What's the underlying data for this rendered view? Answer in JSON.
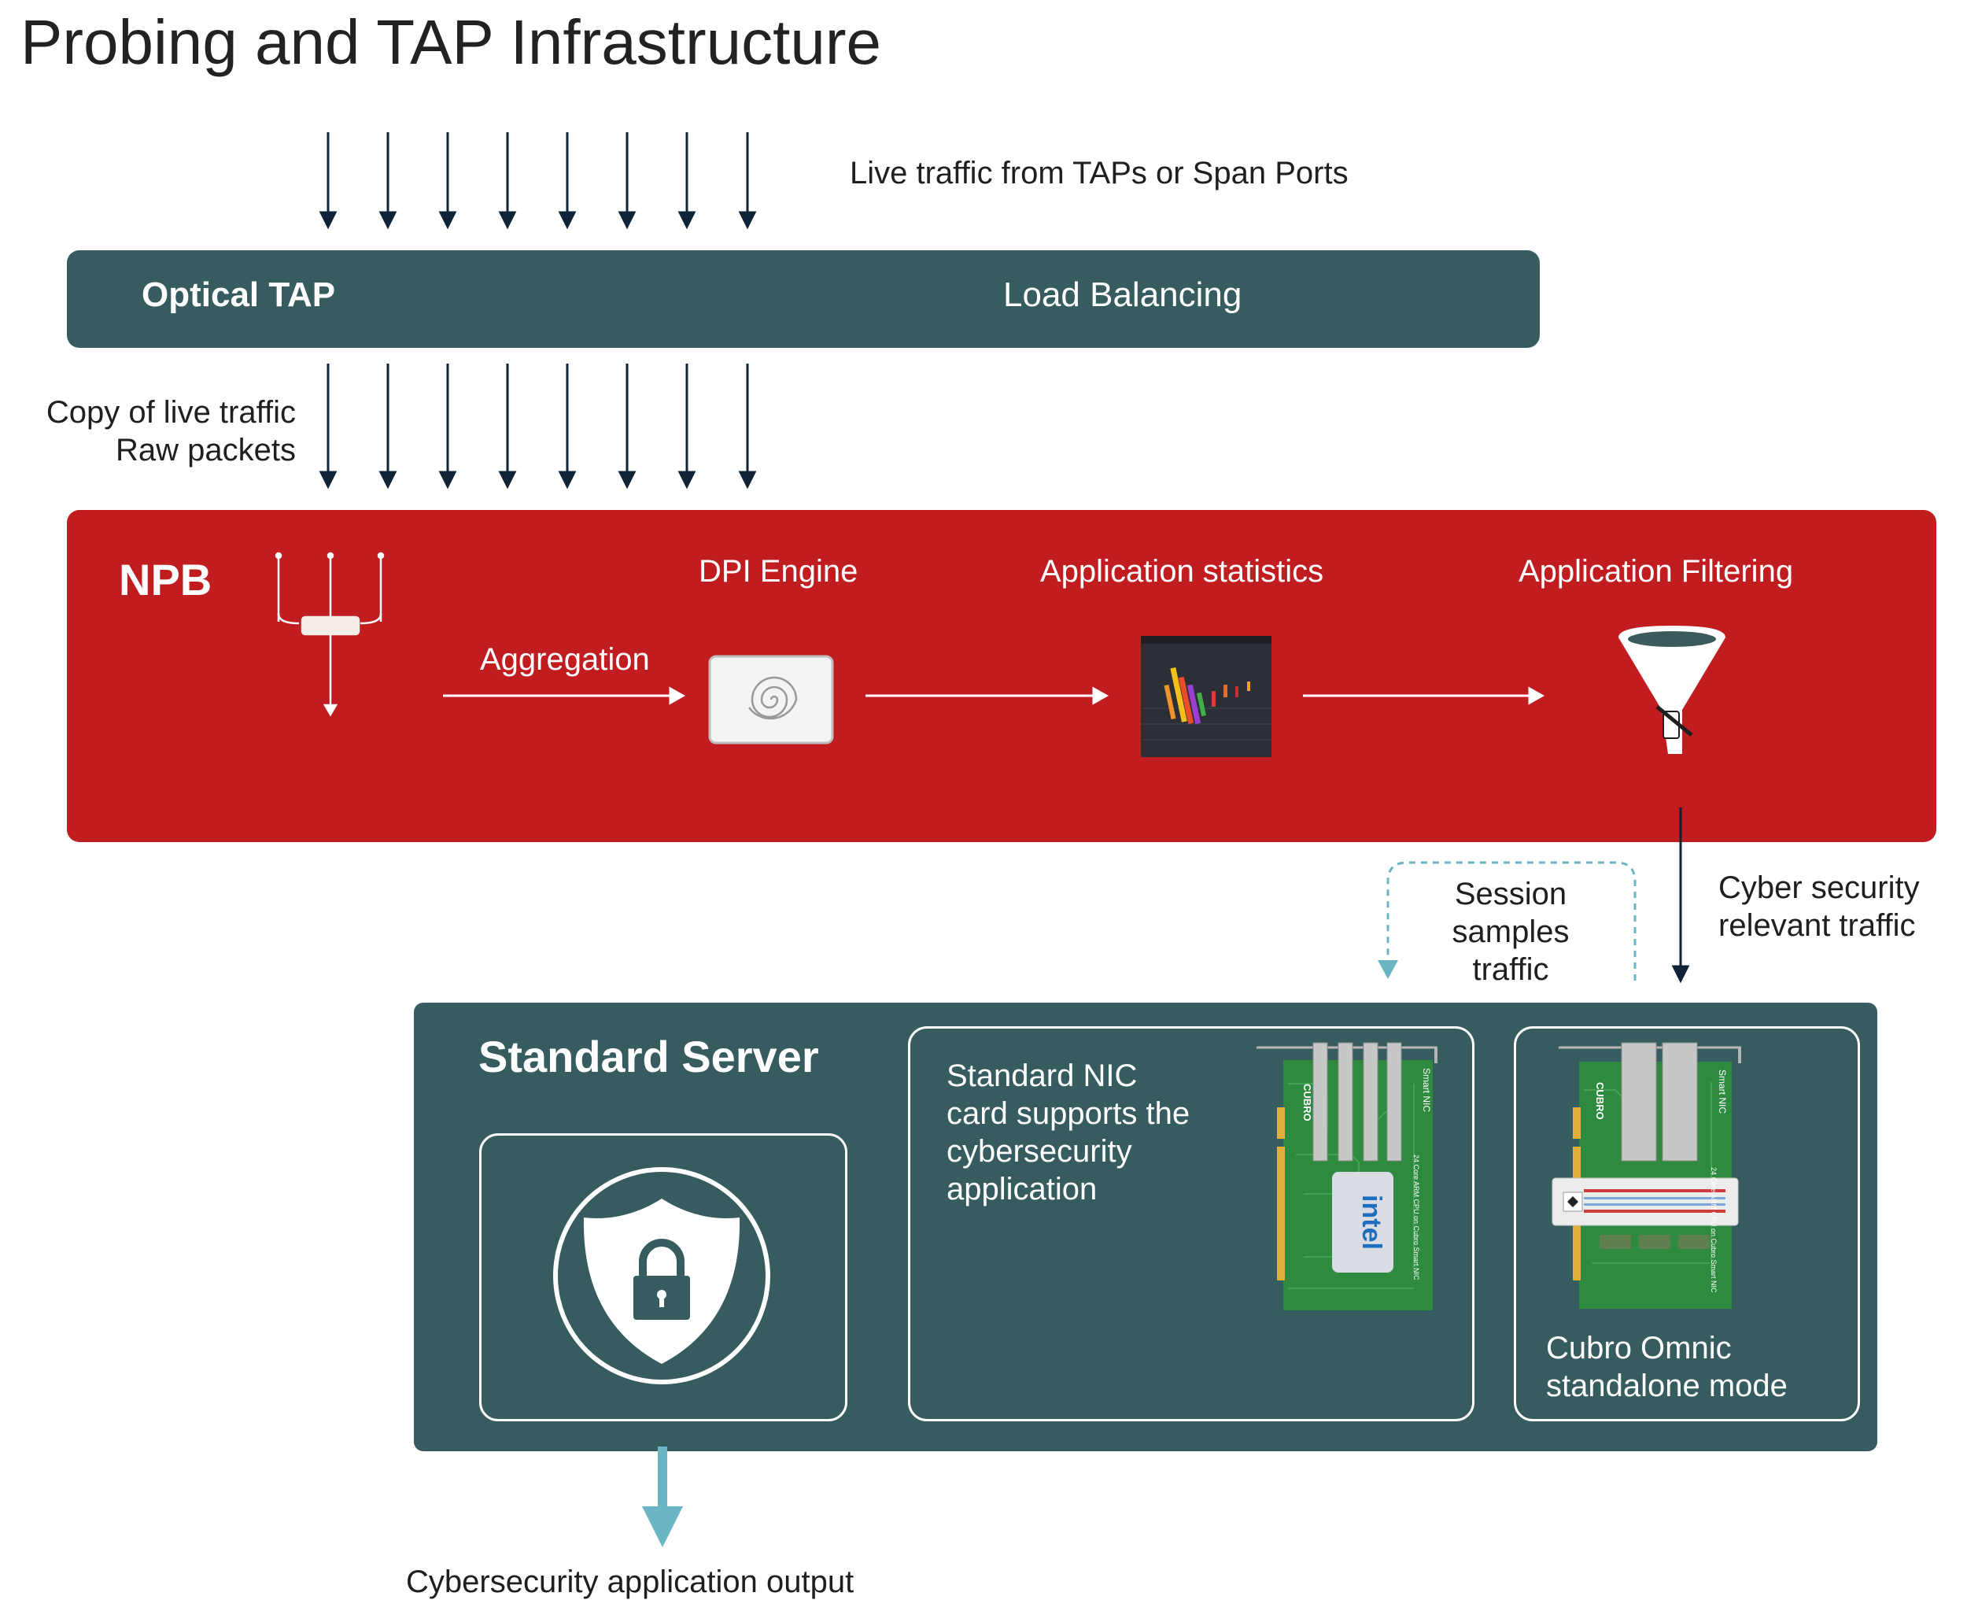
{
  "title": "Probing and TAP Infrastructure",
  "live_traffic_label": "Live traffic from TAPs or Span Ports",
  "tap_bar": {
    "left_label": "Optical TAP",
    "right_label": "Load Balancing"
  },
  "copy_label": {
    "line1": "Copy of live traffic",
    "line2": "Raw packets"
  },
  "npb": {
    "title": "NPB",
    "aggregation": "Aggregation",
    "dpi_engine": "DPI Engine",
    "app_statistics": "Application statistics",
    "app_filtering": "Application Filtering"
  },
  "session_label": {
    "line1": "Session",
    "line2": "samples",
    "line3": "traffic"
  },
  "cyber_label": {
    "line1": "Cyber security",
    "line2": "relevant traffic"
  },
  "server": {
    "title": "Standard Server",
    "nic_text": [
      "Standard NIC",
      "card supports the",
      "cybersecurity",
      "application"
    ],
    "omnic_text": [
      "Cubro Omnic",
      "standalone mode"
    ],
    "card_brand": "CUBRO",
    "card_model": "Smart NIC",
    "card_spec": "24 Core ARM CPU on Cubro Smart NIC",
    "chip_brand": "intel"
  },
  "output_label": "Cybersecurity application output",
  "colors": {
    "teal": "#365c60",
    "red": "#c11c20",
    "arrow_dark": "#0f2436",
    "accent_blue": "#6ab4c4"
  }
}
